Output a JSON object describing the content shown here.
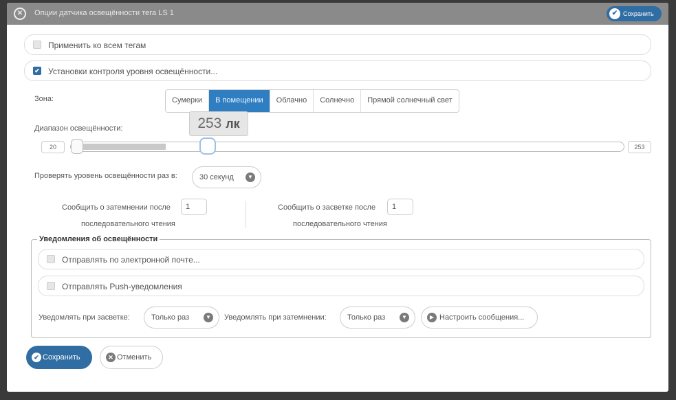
{
  "dialog": {
    "title": "Опции датчика освещённости тега LS 1",
    "top_save_label": "Сохранить"
  },
  "options": {
    "apply_all_label": "Применить ко всем тегам",
    "apply_all_checked": false,
    "light_control_label": "Установки контроля уровня освещённости...",
    "light_control_checked": true
  },
  "zone": {
    "label": "Зона:",
    "options": [
      "Сумерки",
      "В помещении",
      "Облачно",
      "Солнечно",
      "Прямой солнечный свет"
    ],
    "selected": "В помещении"
  },
  "range": {
    "label": "Диапазон освещённости:",
    "min_value": "20",
    "max_value": "253",
    "tooltip_value": "253",
    "tooltip_unit": "лк",
    "handle_fraction": 0.237
  },
  "check_interval": {
    "label": "Проверять уровень освещённости раз в:",
    "value": "30 секунд"
  },
  "notify_dark": {
    "label_before": "Сообщить о затемнении после",
    "value": "1",
    "label_after": "последовательного чтения"
  },
  "notify_light": {
    "label_before": "Сообщить о засветке после",
    "value": "1",
    "label_after": "последовательного чтения"
  },
  "notifications": {
    "legend": "Уведомления об освещённости",
    "email_label": "Отправлять по электронной почте...",
    "email_checked": false,
    "push_label": "Отправлять Push-уведомления",
    "push_checked": false,
    "on_light_label": "Уведомлять при засветке:",
    "on_light_value": "Только раз",
    "on_dark_label": "Уведомлять при затемнении:",
    "on_dark_value": "Только раз",
    "configure_label": "Настроить сообщения..."
  },
  "footer": {
    "save_label": "Сохранить",
    "cancel_label": "Отменить"
  },
  "icons": {
    "close": "close-icon",
    "check": "check-icon",
    "dropdown": "chevron-down-icon",
    "arrow": "arrow-right-icon",
    "cancel": "cancel-icon"
  },
  "colors": {
    "primary": "#2f6da3",
    "active_segment": "#2f7ec1",
    "titlebar": "#8a8a8a"
  }
}
